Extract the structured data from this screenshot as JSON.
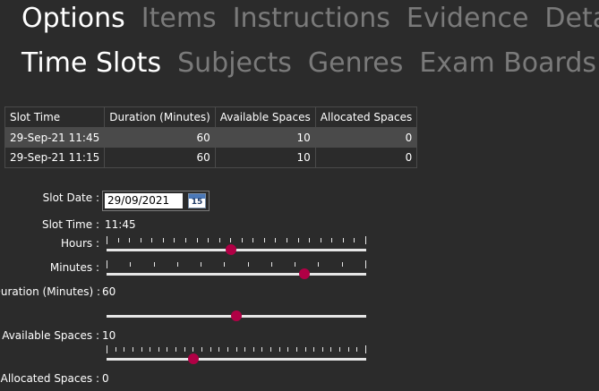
{
  "tabs_row1": [
    "Options",
    "Items",
    "Instructions",
    "Evidence",
    "Detail"
  ],
  "tabs_row2": [
    "Time Slots",
    "Subjects",
    "Genres",
    "Exam Boards"
  ],
  "active_tab_row1": "Options",
  "active_tab_row2": "Time Slots",
  "table": {
    "columns": [
      "Slot Time",
      "Duration (Minutes)",
      "Available Spaces",
      "Allocated Spaces"
    ],
    "rows": [
      [
        "29-Sep-21 11:45",
        "60",
        "10",
        "0"
      ],
      [
        "29-Sep-21 11:15",
        "60",
        "10",
        "0"
      ]
    ],
    "selected_row": 0
  },
  "form": {
    "slot_date_label": "Slot Date :",
    "slot_date_value": "29/09/2021",
    "calendar_day": "15",
    "slot_time_label": "Slot Time :",
    "slot_time_value": "11:45",
    "hours_label": "Hours :",
    "minutes_label": "Minutes :",
    "duration_label": "Duration (Minutes) :",
    "duration_value": "60",
    "available_label": "Available Spaces :",
    "available_value": "10",
    "allocated_label": "Allocated Spaces :",
    "allocated_value": "0"
  },
  "sliders": {
    "hours": {
      "min": 0,
      "max": 23,
      "value": 11
    },
    "minutes": {
      "min": 0,
      "max": 59,
      "value": 45
    },
    "duration": {
      "min": 0,
      "max": 120,
      "value": 60
    },
    "available": {
      "min": 0,
      "max": 30,
      "value": 10
    }
  },
  "colors": {
    "background": "#2b2b2b",
    "accent": "#b00045",
    "inactive_tab": "#7a7a7a",
    "selected_row": "#4a4a4a"
  }
}
